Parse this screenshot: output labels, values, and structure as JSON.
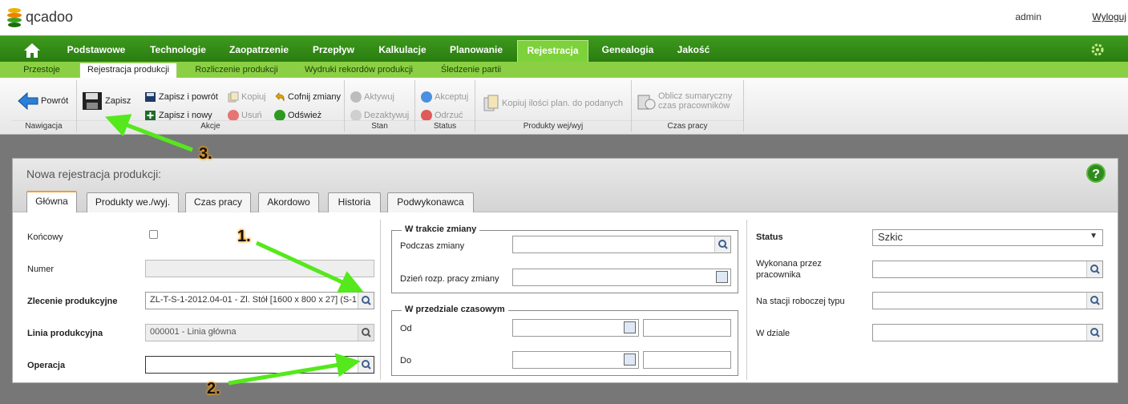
{
  "app": {
    "logo_text": "qcadoo",
    "user": "admin",
    "logout": "Wyloguj"
  },
  "main_nav": [
    {
      "label": ""
    },
    {
      "label": "Podstawowe"
    },
    {
      "label": "Technologie"
    },
    {
      "label": "Zaopatrzenie"
    },
    {
      "label": "Przepływ"
    },
    {
      "label": "Kalkulacje"
    },
    {
      "label": "Planowanie"
    },
    {
      "label": "Rejestracja"
    },
    {
      "label": "Genealogia"
    },
    {
      "label": "Jakość"
    }
  ],
  "sub_nav": [
    {
      "label": "Przestoje"
    },
    {
      "label": "Rejestracja produkcji"
    },
    {
      "label": "Rozliczenie produkcji"
    },
    {
      "label": "Wydruki rekordów produkcji"
    },
    {
      "label": "Śledzenie partii"
    }
  ],
  "toolbar": {
    "nav_group": "Nawigacja",
    "back": "Powrót",
    "save": "Zapisz",
    "save_back": "Zapisz i powrót",
    "save_new": "Zapisz i nowy",
    "copy": "Kopiuj",
    "delete": "Usuń",
    "undo": "Cofnij zmiany",
    "refresh": "Odśwież",
    "actions_group": "Akcje",
    "activate": "Aktywuj",
    "deactivate": "Dezaktywuj",
    "state_group": "Stan",
    "accept": "Akceptuj",
    "reject": "Odrzuć",
    "status_group": "Status",
    "copy_qty": "Kopiuj ilości plan. do podanych",
    "products_group": "Produkty wej/wyj",
    "calc_time_1": "Oblicz sumaryczny",
    "calc_time_2": "czas pracowników",
    "worktime_group": "Czas pracy"
  },
  "panel": {
    "title": "Nowa rejestracja produkcji:",
    "help": "?",
    "tabs": [
      "Główna",
      "Produkty we./wyj.",
      "Czas pracy",
      "Akordowo",
      "Historia",
      "Podwykonawca"
    ]
  },
  "form": {
    "final_label": "Końcowy",
    "number_label": "Numer",
    "number_value": "",
    "order_label": "Zlecenie produkcyjne",
    "order_value": "ZL-T-S-1-2012.04-01 - Zl. Stół [1600 x 800 x 27] (S-1",
    "line_label": "Linia produkcyjna",
    "line_value": "000001 - Linia główna",
    "operation_label": "Operacja",
    "operation_value": "",
    "shift_legend": "W trakcie zmiany",
    "during_shift_label": "Podczas zmiany",
    "shift_day_label": "Dzień rozp. pracy zmiany",
    "interval_legend": "W przedziale czasowym",
    "from_label": "Od",
    "to_label": "Do",
    "status_label": "Status",
    "status_value": "Szkic",
    "done_by_label_1": "Wykonana przez",
    "done_by_label_2": "pracownika",
    "workstation_label": "Na stacji roboczej typu",
    "division_label": "W dziale"
  },
  "annotations": {
    "a1": "1.",
    "a2": "2.",
    "a3": "3."
  },
  "colors": {
    "nav_green": "#2a7d10",
    "subnav_green": "#8bd044",
    "arrow_green": "#55e81c",
    "number_glow": "#ff9a00"
  }
}
